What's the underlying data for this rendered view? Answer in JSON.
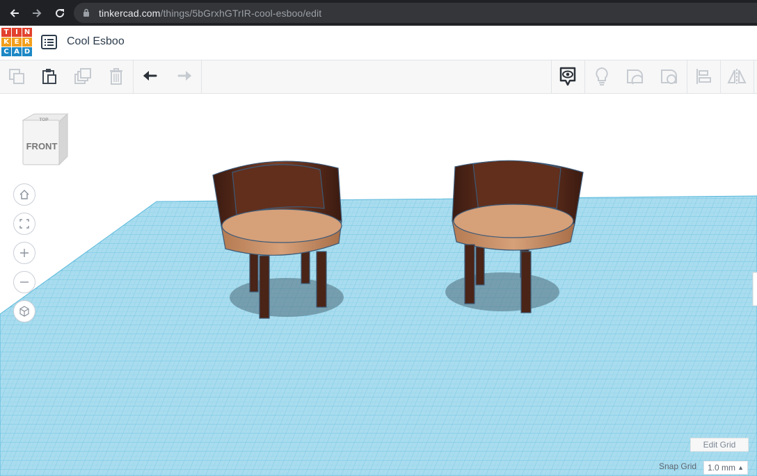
{
  "browser": {
    "url_host": "tinkercad.com",
    "url_path": "/things/5bGrxhGTrIR-cool-esboo/edit"
  },
  "header": {
    "logo_letters": [
      "T",
      "I",
      "N",
      "K",
      "E",
      "R",
      "C",
      "A",
      "D"
    ],
    "logo_colors": [
      "#e2412d",
      "#e2412d",
      "#e2412d",
      "#f29f1c",
      "#f29f1c",
      "#f29f1c",
      "#1e88c6",
      "#1e88c6",
      "#1e88c6"
    ],
    "design_title": "Cool Esboo"
  },
  "toolbar": {
    "left_tools": [
      "copy-icon",
      "paste-icon",
      "duplicate-icon",
      "delete-icon",
      "undo-icon",
      "redo-icon"
    ],
    "right_tools": [
      "notes-visibility-icon",
      "light-bulb-icon",
      "shape-outline-icon",
      "hole-shape-icon",
      "align-icon",
      "mirror-icon"
    ]
  },
  "view_cube": {
    "top_label": "TOP",
    "front_label": "FRONT"
  },
  "view_controls": [
    "home-view-icon",
    "fit-view-icon",
    "zoom-in-icon",
    "zoom-out-icon",
    "perspective-icon"
  ],
  "workplane": {
    "edit_grid_label": "Edit Grid",
    "snap_grid_label": "Snap Grid",
    "snap_grid_value": "1.0 mm"
  },
  "colors": {
    "grid_fill": "#a9dcee",
    "grid_line": "#58b8dc",
    "seat_top": "#d6a079",
    "chair_wood": "#5a2c1a"
  }
}
